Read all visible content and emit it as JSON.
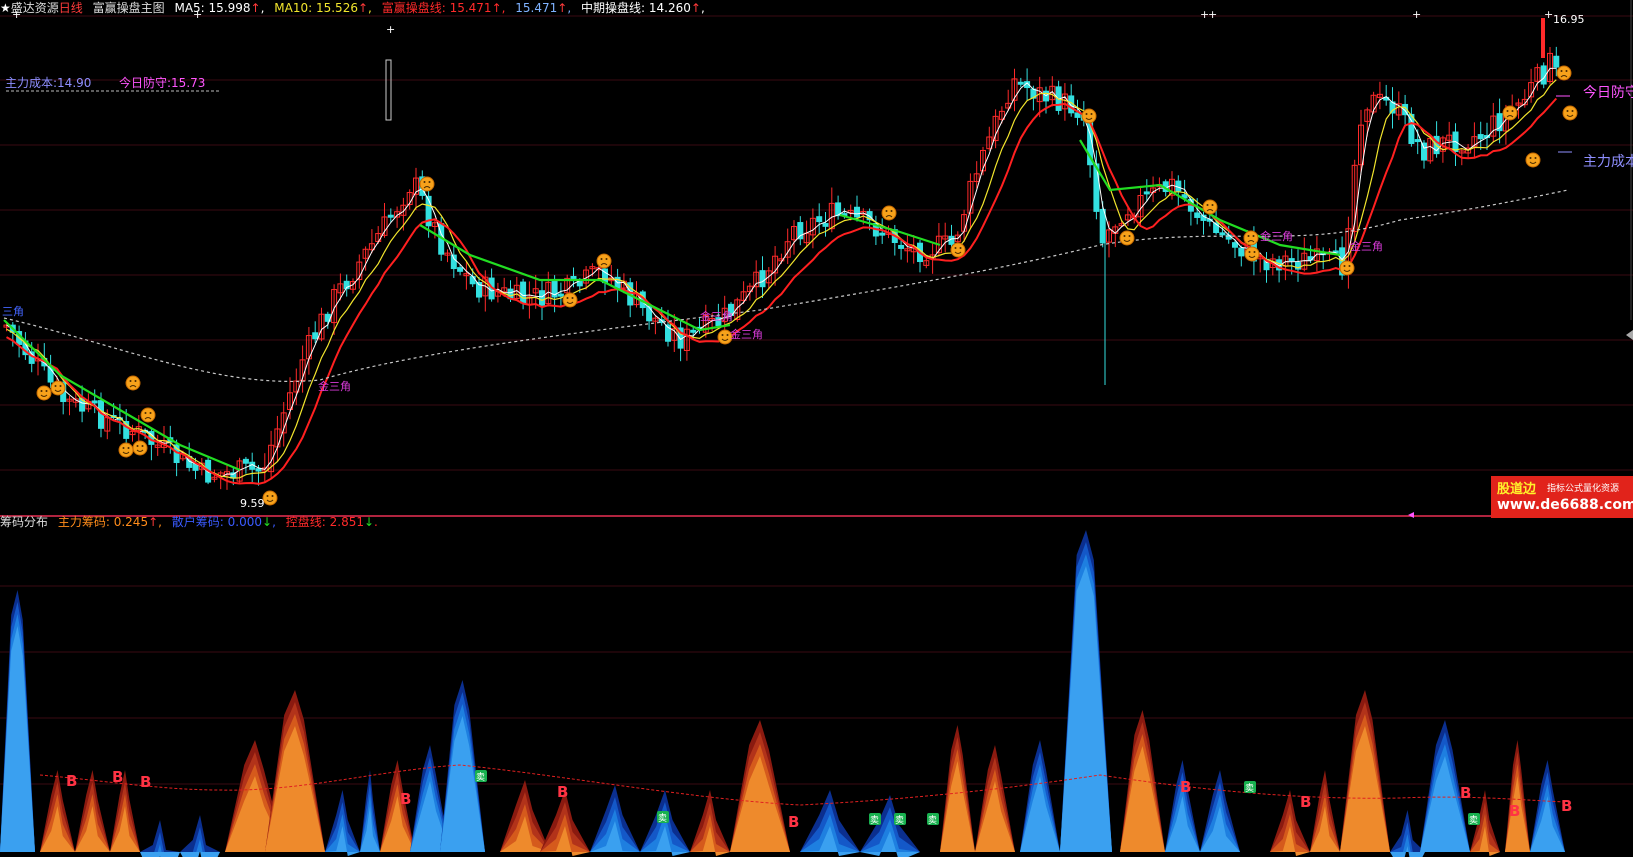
{
  "main_header": {
    "star": "★",
    "title": "盛达资源",
    "period": "日线",
    "indicator": "富赢操盘主图",
    "ma5_label": "MA5:",
    "ma5_value": "15.998",
    "ma10_label": "MA10:",
    "ma10_value": "15.526",
    "operate_label": "富赢操盘线:",
    "operate_value1": "15.471",
    "operate_value2": "15.471",
    "midterm_label": "中期操盘线:",
    "midterm_value": "14.260",
    "up_arrow": "↑"
  },
  "sub_header": {
    "title": "筹码分布",
    "main_chip_label": "主力筹码:",
    "main_chip_value": "0.245",
    "retail_chip_label": "散户筹码:",
    "retail_chip_value": "0.000",
    "control_label": "控盘线:",
    "control_value": "2.851",
    "up_arrow": "↑",
    "down_arrow": "↓"
  },
  "overlay": {
    "main_cost_label": "主力成本:14.90",
    "defense_label": "今日防守:15.73",
    "right_defense": "今日防守",
    "right_cost": "主力成本",
    "high_price": "16.95",
    "low_price": "9.59",
    "triangle_label": "金三角",
    "left_triangle_fragment": "三角",
    "buy_mark": "B",
    "sell_mark": "卖"
  },
  "watermark": {
    "brand": "股道边",
    "tagline": "指标公式量化资源",
    "url": "www.de6688.com"
  },
  "colors": {
    "background": "#000000",
    "up_candle": "#ff2a2a",
    "down_candle": "#33e0e0",
    "ma5": "#ffffff",
    "ma10": "#f2e52d",
    "operate_line": "#ff2020",
    "midterm_line": "#22dd22",
    "long_line": "#c8c8c8",
    "separator": "#b0243f",
    "buy_mark": "#ff3344",
    "sell_mark": "#18b14f",
    "chip_blue": "#1e7fe0",
    "chip_orange": "#e06b1a"
  },
  "chart_data": {
    "type": "candlestick",
    "price_high": 16.95,
    "price_low": 9.59,
    "ma5": 15.998,
    "ma10": 15.526,
    "operate_line": 15.471,
    "midterm_line": 14.26,
    "main_cost": 14.9,
    "defense": 15.73,
    "main_chip": 0.245,
    "retail_chip": 0.0,
    "control_line": 2.851
  }
}
